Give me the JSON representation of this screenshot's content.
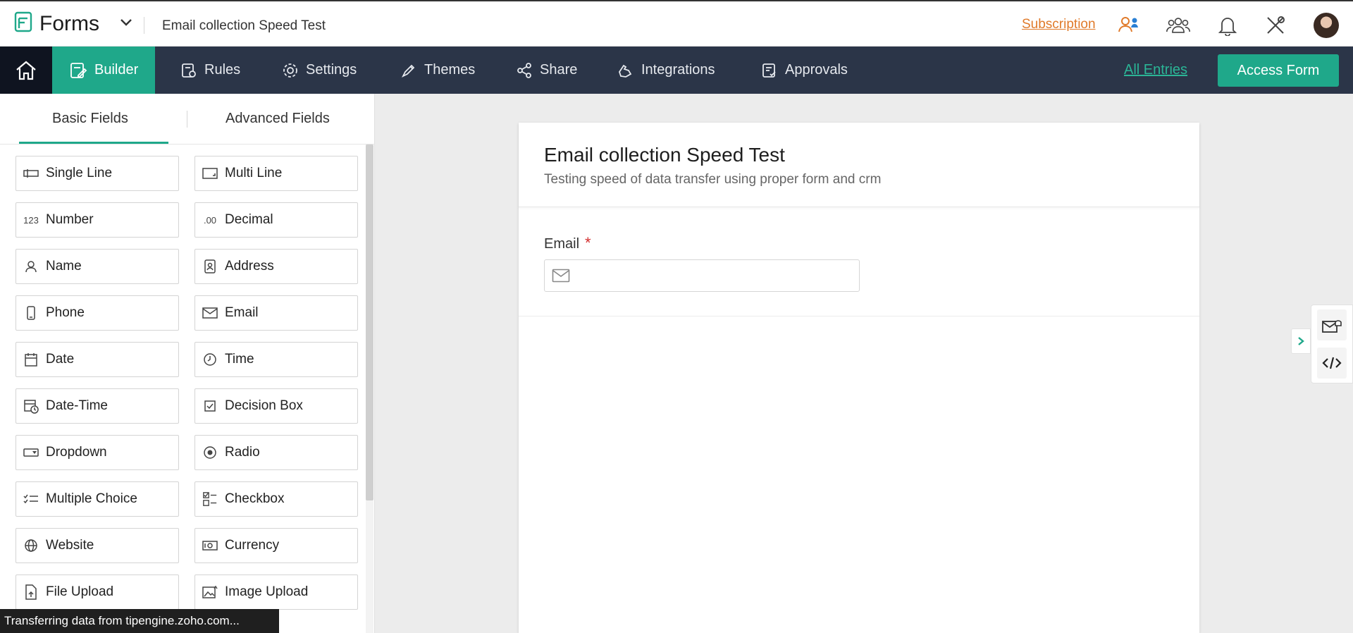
{
  "header": {
    "app_name": "Forms",
    "form_title": "Email collection Speed Test",
    "subscription": "Subscription"
  },
  "nav": {
    "items": [
      {
        "label": "Builder",
        "icon": "builder-icon",
        "active": true
      },
      {
        "label": "Rules",
        "icon": "rules-icon",
        "active": false
      },
      {
        "label": "Settings",
        "icon": "gear-icon",
        "active": false
      },
      {
        "label": "Themes",
        "icon": "brush-icon",
        "active": false
      },
      {
        "label": "Share",
        "icon": "share-icon",
        "active": false
      },
      {
        "label": "Integrations",
        "icon": "puzzle-icon",
        "active": false
      },
      {
        "label": "Approvals",
        "icon": "approvals-icon",
        "active": false
      }
    ],
    "all_entries": "All Entries",
    "access_form": "Access Form"
  },
  "left_panel": {
    "tabs": {
      "basic": "Basic Fields",
      "advanced": "Advanced Fields"
    },
    "fields": [
      "Single Line",
      "Multi Line",
      "Number",
      "Decimal",
      "Name",
      "Address",
      "Phone",
      "Email",
      "Date",
      "Time",
      "Date-Time",
      "Decision Box",
      "Dropdown",
      "Radio",
      "Multiple Choice",
      "Checkbox",
      "Website",
      "Currency",
      "File Upload",
      "Image Upload"
    ],
    "number_glyph": "123",
    "decimal_glyph": ".00"
  },
  "form": {
    "title": "Email collection Speed Test",
    "description": "Testing speed of data transfer using proper form and crm",
    "email_label": "Email",
    "required_mark": "*"
  },
  "status_bar": "Transferring data from tipengine.zoho.com...",
  "colors": {
    "accent": "#1fa88a",
    "nav_bg": "#2b3548",
    "subscription": "#e07a2a"
  }
}
